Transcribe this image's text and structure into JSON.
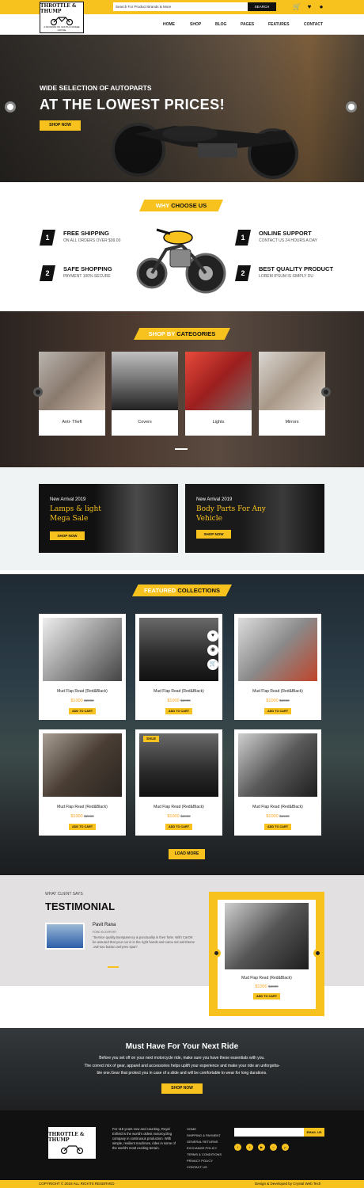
{
  "header": {
    "logo_text": "THROTTLE & THUMP",
    "logo_tagline": "A DIVISION OF SOUTH COFFEE HOUSE",
    "search_placeholder": "Search For Product Brands & More",
    "search_button": "SEARCH"
  },
  "nav": [
    "HOME",
    "SHOP",
    "BLOG",
    "PAGES",
    "FEATURES",
    "CONTACT"
  ],
  "hero": {
    "subtitle": "WIDE SELECTION OF AUTOPARTS",
    "title": "AT THE LOWEST PRICES!",
    "button": "SHOP NOW"
  },
  "why": {
    "tag_white": "WHY",
    "tag_dark": "CHOOSE US",
    "features": [
      {
        "num": "1",
        "title": "FREE SHIPPING",
        "sub": "ON ALL ORDERS OVER $99.00"
      },
      {
        "num": "2",
        "title": "SAFE SHOPPING",
        "sub": "PAYMENT 100% SECURE"
      },
      {
        "num": "1",
        "title": "ONLINE SUPPORT",
        "sub": "CONTACT US 24 HOURS A DAY"
      },
      {
        "num": "2",
        "title": "BEST QUALITY PRODUCT",
        "sub": "LOREM IPSUM IS SIMPLY DU"
      }
    ]
  },
  "categories": {
    "tag_white": "SHOP BY",
    "tag_dark": "CATEGORIES",
    "items": [
      "Anti- Theft",
      "Covers",
      "Lights",
      "Mirrors"
    ]
  },
  "promo": [
    {
      "new": "New Arrival 2019",
      "title1": "Lamps & light",
      "title2": "Mega Sale",
      "button": "SHOP NOW"
    },
    {
      "new": "New Arrival 2019",
      "title1": "Body Parts For Any",
      "title2": "Vehicle",
      "button": "SHOP NOW"
    }
  ],
  "featured": {
    "tag_white": "FEATURED",
    "tag_dark": "COLLECTIONS",
    "sale_badge": "SALE",
    "products": [
      {
        "name": "Mud Flap Read (Red&Black)",
        "price": "$1000",
        "old": "$2000",
        "cart": "ADD TO CART"
      },
      {
        "name": "Mud Flap Read (Red&Black)",
        "price": "$1000",
        "old": "$2000",
        "cart": "ADD TO CART"
      },
      {
        "name": "Mud Flap Read (Red&Black)",
        "price": "$1000",
        "old": "$2000",
        "cart": "ADD TO CART"
      },
      {
        "name": "Mud Flap Read (Red&Black)",
        "price": "$1000",
        "old": "$2000",
        "cart": "ADD TO CART"
      },
      {
        "name": "Mud Flap Read (Red&Black)",
        "price": "$1000",
        "old": "$2000",
        "cart": "ADD TO CART"
      },
      {
        "name": "Mud Flap Read (Red&Black)",
        "price": "$1000",
        "old": "$2000",
        "cart": "ADD TO CART"
      }
    ],
    "load_more": "LOAD MORE"
  },
  "testimonial": {
    "kicker": "WHAT CLIENT SAYS",
    "title": "TESTIMONIAL",
    "name": "Pavit Rana",
    "role": "FORD ECOSPORT",
    "quote": "\"Service quality,transparency & punctuality is their forte. With CarOK be assured that your car is in the right hands.owl-carou sel.owl-theme .owl-nav button.owl-prev span\"",
    "product": {
      "name": "Mud Flap Read (Red&Black)",
      "price": "$1000",
      "old": "$2000",
      "cart": "ADD TO CART"
    }
  },
  "must": {
    "title": "Must Have For Your Next Ride",
    "line1": "Before you set off on your next motorcycle ride, make sure you have these essentials with you.",
    "line2": "The correct mix of gear, apparel and accessories helps uplift your experience and make your ride an unforgetta-",
    "line3": "ble one.Gear that protect you in case of a slide and will be comfortable to wear for long durations.",
    "button": "SHOP NOW"
  },
  "footer": {
    "about": "For 118 years now and counting, Royal Enfield is the world's oldest motorcycling company in continuous production. With simple, resilient machines, rides in some of the world's most exciting terrain.",
    "links": [
      "HOME",
      "SHIPPING & PAYMENT",
      "GENERAL RETURNS",
      "EXCHANGE POLICY",
      "TERMS & CONDITIONS",
      "PRIVACY POLICY",
      "CONTACT US"
    ],
    "email_button": "EMAIL US",
    "copyright": "COPYRIGHT © 2019 ALL RIGHTS RESERVED",
    "credit": "Design & Developed by Crystal Web Tech"
  },
  "colors": {
    "accent": "#f7c21e",
    "dark": "#111111"
  }
}
